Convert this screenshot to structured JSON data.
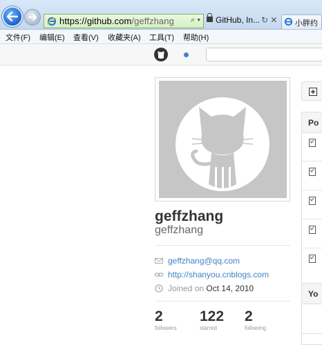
{
  "browser": {
    "address": {
      "scheme_host": "https://github.com",
      "path": "/geffzhang",
      "controls": "⌕ ▾"
    },
    "cert_label": "GitHub, In...",
    "addr_controls": "↻ ✕",
    "tab": {
      "title": "小胖约"
    },
    "menu": [
      "文件(F)",
      "编辑(E)",
      "查看(V)",
      "收藏夹(A)",
      "工具(T)",
      "帮助(H)"
    ],
    "colors": {
      "nav_blue": "#1f62c8",
      "address_green": "#d7f0c4"
    }
  },
  "profile": {
    "fullname": "geffzhang",
    "username": "geffzhang",
    "email": "geffzhang@qq.com",
    "website": "http://shanyou.cnblogs.com",
    "joined_prefix": "Joined on",
    "joined_date": "Oct 14, 2010",
    "stats": [
      {
        "value": "2",
        "label": "followers"
      },
      {
        "value": "122",
        "label": "starred"
      },
      {
        "value": "2",
        "label": "following"
      }
    ]
  },
  "sidebar_right": {
    "popular_heading": "Po",
    "your_heading": "Yo"
  },
  "icons": [
    "back-arrow-icon",
    "forward-arrow-icon",
    "ie-logo-icon",
    "lock-icon",
    "github-octocat-icon",
    "mail-icon",
    "link-icon",
    "clock-icon",
    "repo-icon",
    "add-icon"
  ],
  "colors": {
    "link": "#4183c4",
    "text": "#333333",
    "muted": "#999999",
    "avatar_bg": "#c6c6c6"
  }
}
